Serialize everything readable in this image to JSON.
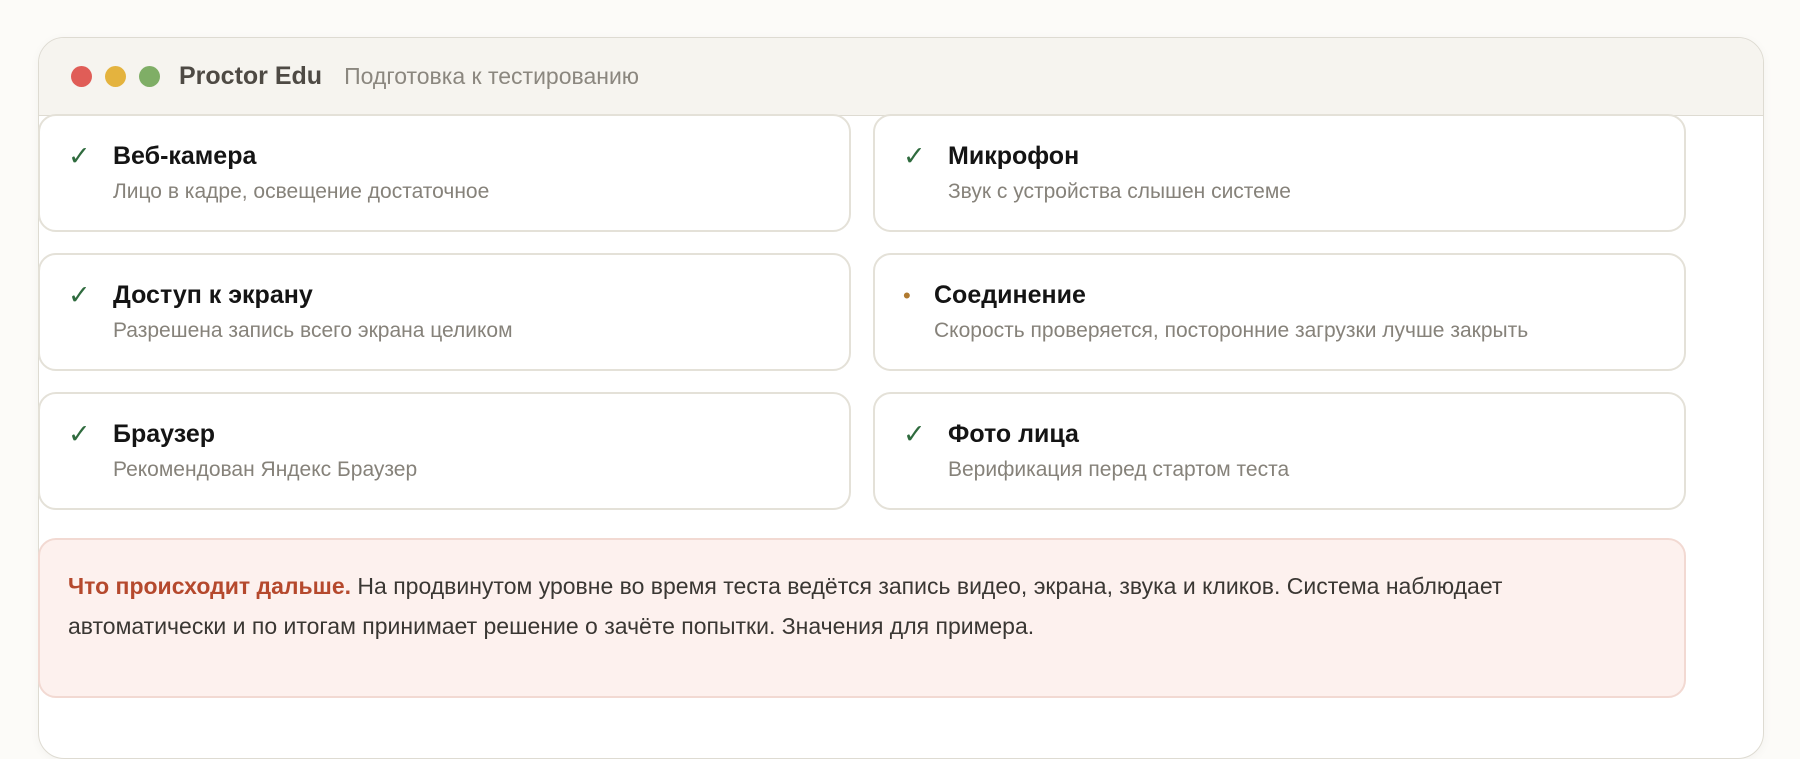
{
  "window": {
    "app_title": "Proctor Edu",
    "subtitle": "Подготовка к тестированию"
  },
  "checks": [
    {
      "title": "Веб-камера",
      "desc": "Лицо в кадре, освещение достаточное",
      "status": "ok",
      "icon": "check-icon"
    },
    {
      "title": "Микрофон",
      "desc": "Звук с устройства слышен системе",
      "status": "ok",
      "icon": "check-icon"
    },
    {
      "title": "Доступ к экрану",
      "desc": "Разрешена запись всего экрана целиком",
      "status": "ok",
      "icon": "check-icon"
    },
    {
      "title": "Соединение",
      "desc": "Скорость проверяется, посторонние загрузки лучше закрыть",
      "status": "pending",
      "icon": "pending-dot-icon"
    },
    {
      "title": "Браузер",
      "desc": "Рекомендован Яндекс Браузер",
      "status": "ok",
      "icon": "check-icon"
    },
    {
      "title": "Фото лица",
      "desc": "Верификация перед стартом теста",
      "status": "ok",
      "icon": "check-icon"
    }
  ],
  "icons": {
    "check": "✓",
    "pending": "•"
  },
  "notice": {
    "lead": "Что происходит дальше.",
    "body": "На продвинутом уровне во время теста ведётся запись видео, экрана, звука и кликов. Система наблюдает автоматически и по итогам принимает решение о зачёте попытки. Значения для примера."
  },
  "colors": {
    "ok": "#2f6b3e",
    "pending": "#b07a30",
    "accent": "#b5492d"
  }
}
